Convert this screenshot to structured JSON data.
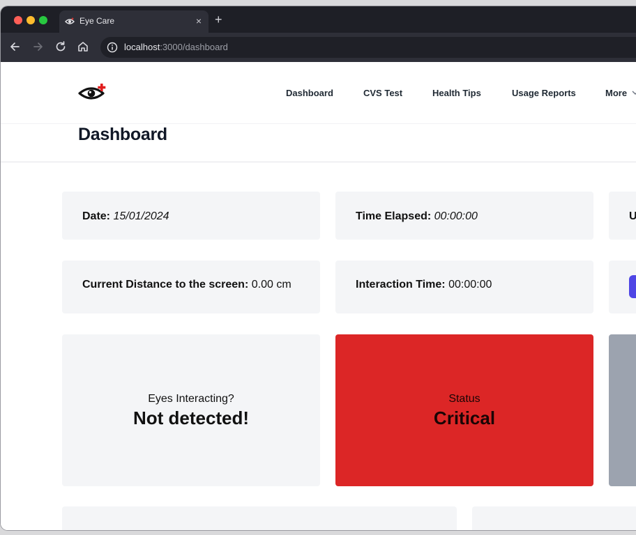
{
  "browser": {
    "tab_title": "Eye Care",
    "tab_close": "×",
    "new_tab": "+",
    "url_host": "localhost",
    "url_path": ":3000/dashboard"
  },
  "nav": {
    "links": [
      "Dashboard",
      "CVS Test",
      "Health Tips",
      "Usage Reports",
      "More"
    ]
  },
  "page_title": "Dashboard",
  "stats": {
    "date_label": "Date:",
    "date_value": "15/01/2024",
    "elapsed_label": "Time Elapsed:",
    "elapsed_value": "00:00:00",
    "third_label": "U",
    "distance_label": "Current Distance to the screen:",
    "distance_value": "0.00 cm",
    "interaction_label": "Interaction Time:",
    "interaction_value": "00:00:00"
  },
  "status_cards": {
    "eyes_label": "Eyes Interacting?",
    "eyes_value": "Not detected!",
    "status_label": "Status",
    "status_value": "Critical"
  },
  "colors": {
    "accent": "#4f46e5",
    "status_critical": "#dc2626",
    "card_bg": "#f4f5f7",
    "inactive_card": "#9ca3af"
  },
  "icons": {
    "logo": "eye-with-red-cross",
    "info": "info-icon",
    "back": "arrow-left-icon",
    "forward": "arrow-right-icon",
    "reload": "reload-icon",
    "home": "home-icon",
    "more": "chevron-down-icon"
  }
}
